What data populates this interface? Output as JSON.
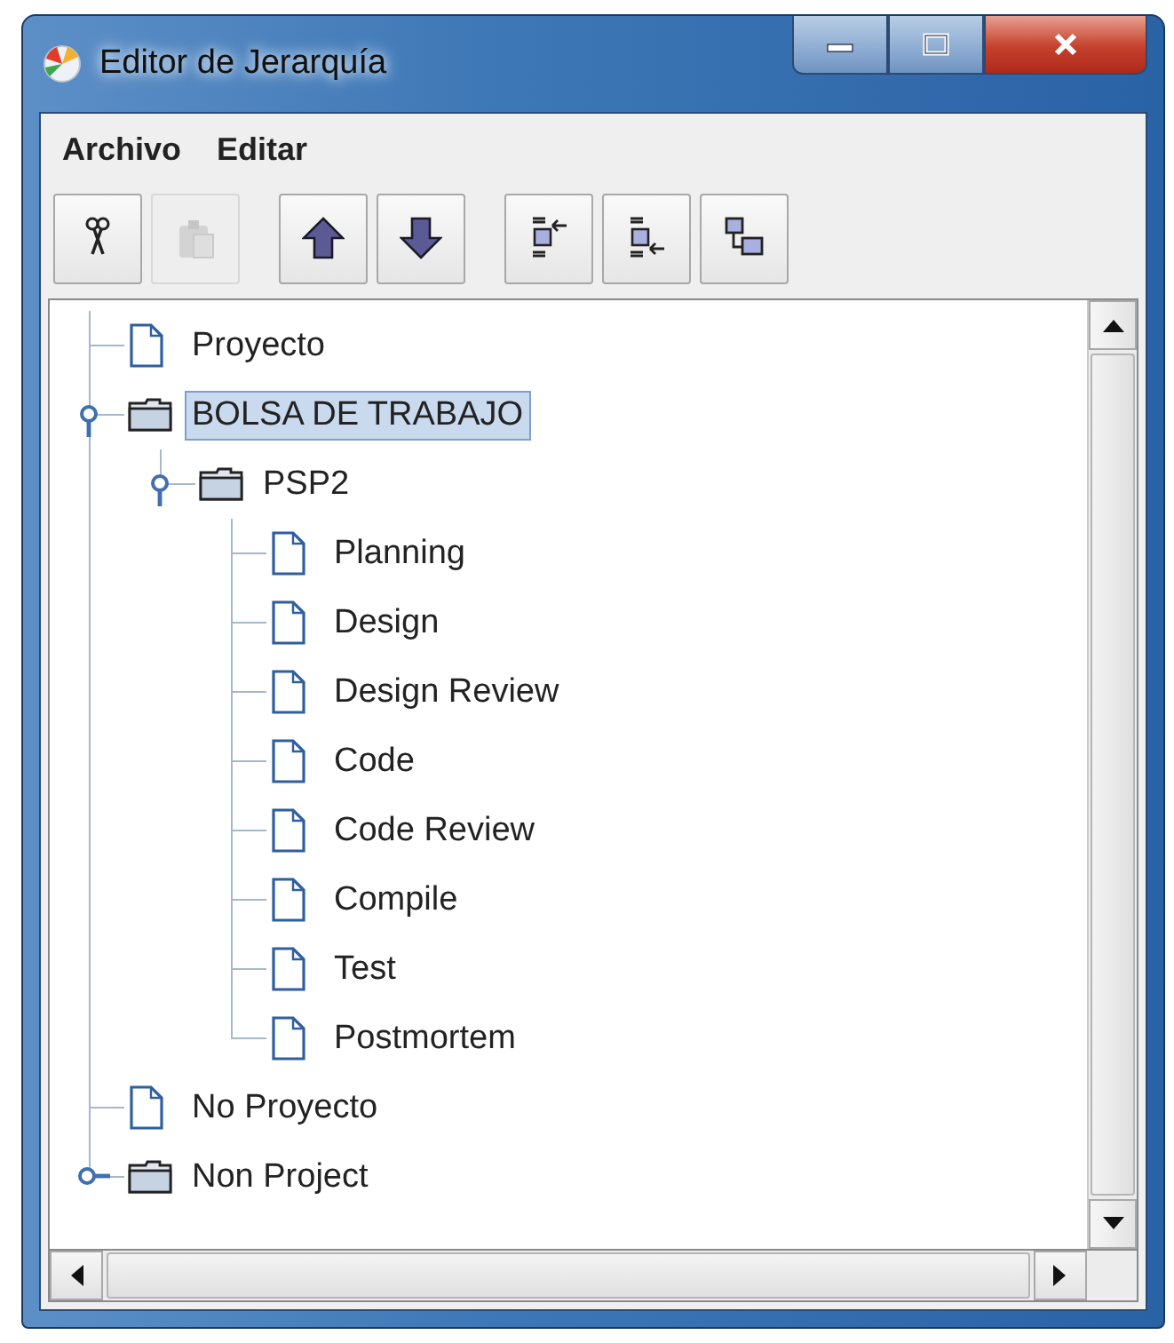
{
  "window": {
    "title": "Editor de Jerarquía"
  },
  "menu": [
    {
      "label": "Archivo"
    },
    {
      "label": "Editar"
    }
  ],
  "toolbar": [
    [
      {
        "kind": "cut",
        "disabled": false
      },
      {
        "kind": "paste",
        "disabled": true
      }
    ],
    [
      {
        "kind": "up",
        "disabled": false
      },
      {
        "kind": "down",
        "disabled": false
      }
    ],
    [
      {
        "kind": "insert-before",
        "disabled": false
      },
      {
        "kind": "insert-after",
        "disabled": false
      },
      {
        "kind": "insert-child",
        "disabled": false
      }
    ]
  ],
  "tree": [
    {
      "label": "Proyecto",
      "kind": "file",
      "selected": false
    },
    {
      "label": "BOLSA DE TRABAJO",
      "kind": "folder",
      "expanded": true,
      "selected": true,
      "children": [
        {
          "label": "PSP2",
          "kind": "folder",
          "expanded": true,
          "selected": false,
          "children": [
            {
              "label": "Planning",
              "kind": "file",
              "selected": false
            },
            {
              "label": "Design",
              "kind": "file",
              "selected": false
            },
            {
              "label": "Design Review",
              "kind": "file",
              "selected": false
            },
            {
              "label": "Code",
              "kind": "file",
              "selected": false
            },
            {
              "label": "Code Review",
              "kind": "file",
              "selected": false
            },
            {
              "label": "Compile",
              "kind": "file",
              "selected": false
            },
            {
              "label": "Test",
              "kind": "file",
              "selected": false
            },
            {
              "label": "Postmortem",
              "kind": "file",
              "selected": false
            }
          ]
        }
      ]
    },
    {
      "label": "No Proyecto",
      "kind": "file",
      "selected": false
    },
    {
      "label": "Non Project",
      "kind": "folder",
      "expanded": false,
      "selected": false
    }
  ]
}
